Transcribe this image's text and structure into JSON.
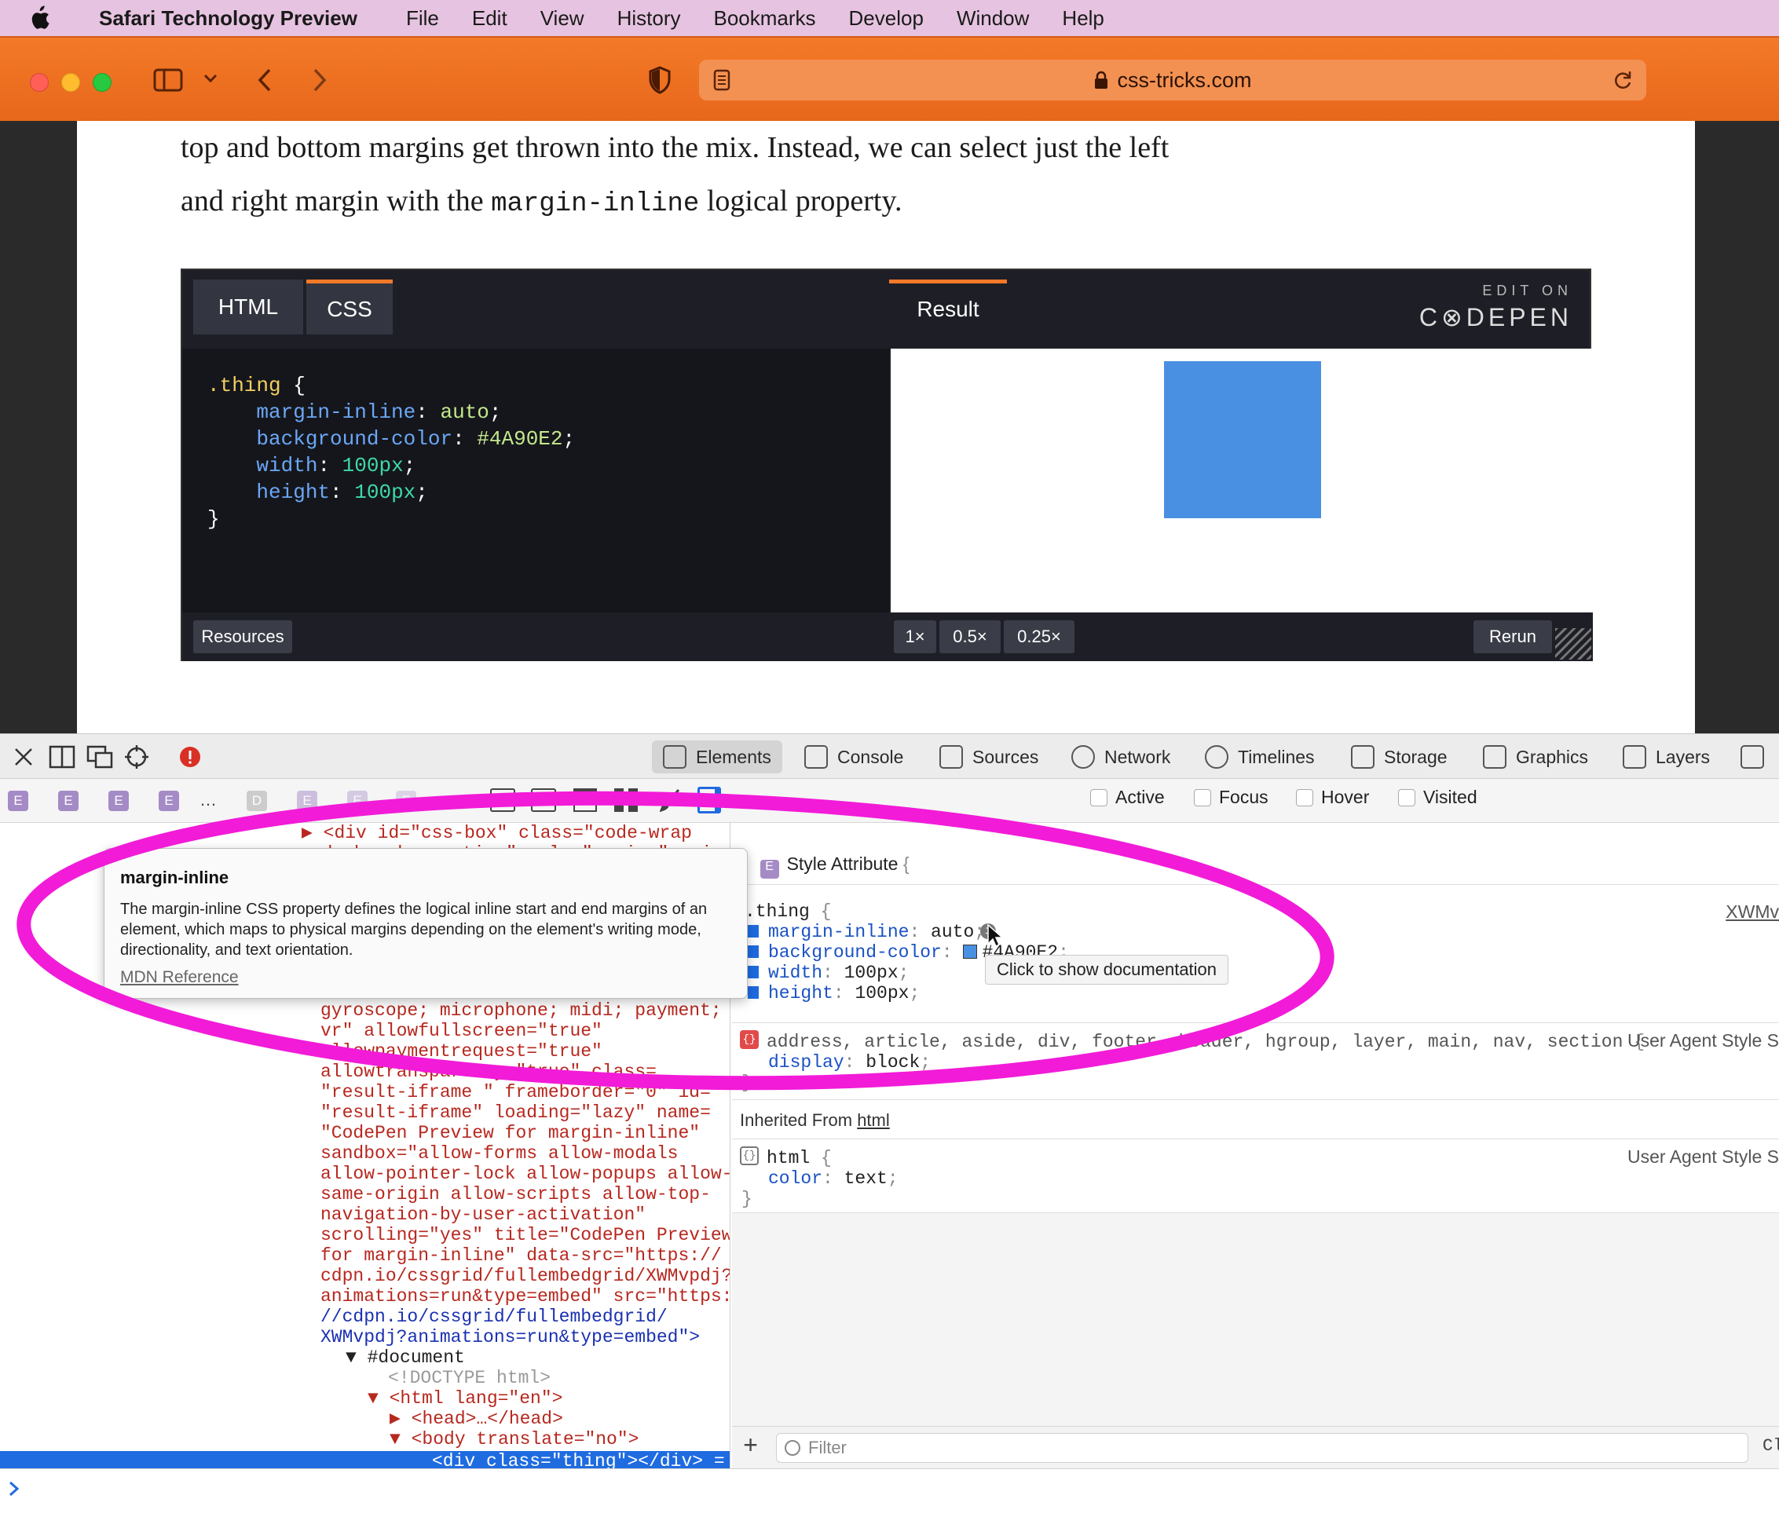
{
  "menubar": {
    "app": "Safari Technology Preview",
    "items": [
      "File",
      "Edit",
      "View",
      "History",
      "Bookmarks",
      "Develop",
      "Window",
      "Help"
    ]
  },
  "toolbar": {
    "url": "css-tricks.com"
  },
  "article": {
    "line1": "top and bottom margins get thrown into the mix. Instead, we can select just the left",
    "line2_pre": "and right margin with the ",
    "line2_code": "margin-inline",
    "line2_post": " logical property."
  },
  "codepen": {
    "tabs": [
      "HTML",
      "CSS"
    ],
    "active_tab": "CSS",
    "result_tab": "Result",
    "edit_on": "EDIT ON",
    "brand": "C⊗DEPEN",
    "code": {
      "selector": ".thing",
      "open": " {",
      "close": "}",
      "decls": [
        {
          "prop": "margin-inline",
          "val": "auto"
        },
        {
          "prop": "background-color",
          "val": "#4A90E2"
        },
        {
          "prop": "width",
          "val": "100px"
        },
        {
          "prop": "height",
          "val": "100px"
        }
      ]
    },
    "footer": {
      "resources": "Resources",
      "zoom": [
        "1×",
        "0.5×",
        "0.25×"
      ],
      "rerun": "Rerun"
    }
  },
  "devtools": {
    "tabs": [
      "Elements",
      "Console",
      "Sources",
      "Network",
      "Timelines",
      "Storage",
      "Graphics",
      "Layers"
    ],
    "active_tab": "Elements",
    "pseudo": [
      "Active",
      "Focus",
      "Hover",
      "Visited"
    ],
    "dom_lines": [
      "▶ <div id=\"css-box\" class=\"code-wrap",
      "code-box box-active\" role=\"region\" aria-",
      "gyroscope; microphone; midi; payment;",
      "vr\" allowfullscreen=\"true\"",
      "allowpaymentrequest=\"true\"",
      "allowtransparency=\"true\" class=",
      "\"result-iframe \" frameborder=\"0\" id=",
      "\"result-iframe\" loading=\"lazy\" name=",
      "\"CodePen Preview for margin-inline\"",
      "sandbox=\"allow-forms allow-modals",
      "allow-pointer-lock allow-popups allow-",
      "same-origin allow-scripts allow-top-",
      "navigation-by-user-activation\"",
      "scrolling=\"yes\" title=\"CodePen Preview",
      "for margin-inline\" data-src=\"https://",
      "cdpn.io/cssgrid/fullembedgrid/XWMvpdj?",
      "animations=run&type=embed\" src=\"https:",
      "//cdpn.io/cssgrid/fullembedgrid/",
      "XWMvpdj?animations=run&type=embed\">",
      "▼ #document",
      "<!DOCTYPE html>",
      "▼ <html lang=\"en\">",
      "▶ <head>…</head>",
      "▼ <body translate=\"no\">",
      "<div class=\"thing\"></div> = $"
    ],
    "styles": {
      "style_attr": "Style Attribute",
      "rule_selector": ".thing",
      "rule_source": "XWMv",
      "rule_decls": [
        {
          "prop": "margin-inline",
          "val": "auto"
        },
        {
          "prop": "background-color",
          "val": "#4A90E2"
        },
        {
          "prop": "width",
          "val": "100px"
        },
        {
          "prop": "height",
          "val": "100px"
        }
      ],
      "ua_selector": "address, article, aside, div, footer, header, hgroup, layer, main, nav, section",
      "ua_source": "User Agent Style S",
      "ua_decl": {
        "prop": "display",
        "val": "block"
      },
      "inherited": "Inherited From",
      "inherited_link": "html",
      "html_selector": "html",
      "html_decl": {
        "prop": "color",
        "val": "text"
      },
      "filter_placeholder": "Filter"
    },
    "tooltip": {
      "title": "margin-inline",
      "body": "The margin-inline CSS property defines the logical inline start and end margins of an element, which maps to physical margins depending on the element's writing mode, directionality, and text orientation.",
      "link": "MDN Reference"
    },
    "hint": "Click to show documentation"
  },
  "colors": {
    "accent": "#f37a28",
    "highlight": "#f21bd8",
    "swatch": "#4A90E2",
    "selection": "#1f6be0"
  }
}
